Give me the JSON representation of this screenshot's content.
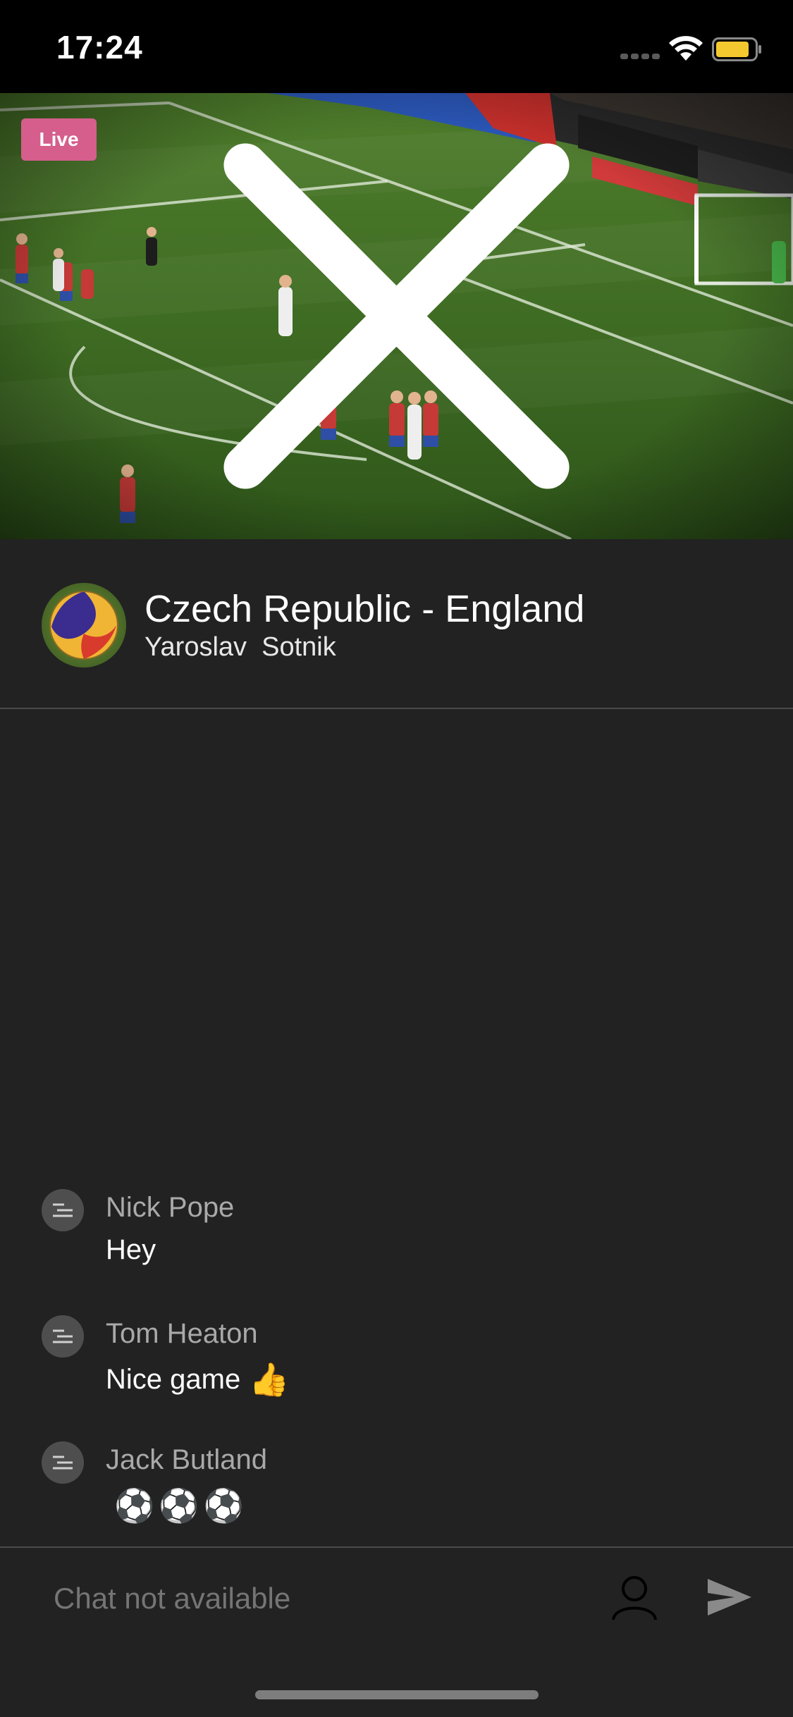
{
  "status_bar": {
    "time": "17:24"
  },
  "video": {
    "live_label": "Live"
  },
  "stream": {
    "title": "Czech Republic - England",
    "author": "Yaroslav  Sotnik"
  },
  "messages": [
    {
      "name": "Nick Pope",
      "text": "Hey",
      "emoji": ""
    },
    {
      "name": "Tom Heaton",
      "text": "Nice game",
      "emoji": "👍"
    },
    {
      "name": "Jack Butland",
      "text": "",
      "emoji": "⚽⚽⚽"
    }
  ],
  "input": {
    "placeholder": "Chat not available"
  },
  "icons": {
    "close": "close-icon",
    "profile": "person-icon",
    "send": "send-icon",
    "wifi": "wifi-icon",
    "battery": "battery-icon"
  },
  "colors": {
    "background": "#222222",
    "live_badge": "#d55e8c",
    "battery_fill": "#f4c930",
    "pitch_green": "#3c6a22"
  }
}
